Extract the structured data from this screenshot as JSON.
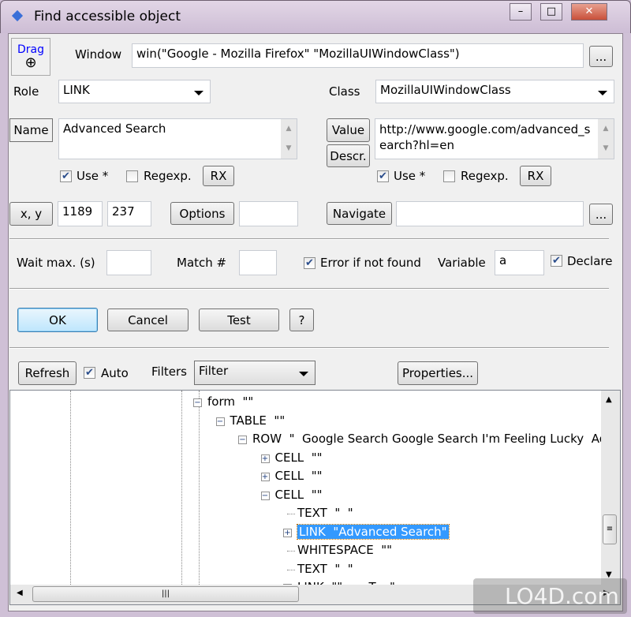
{
  "window": {
    "title": "Find accessible object",
    "minimize": "–",
    "maximize": "□",
    "close": "✕"
  },
  "top": {
    "drag_label": "Drag",
    "window_label": "Window",
    "window_value": "win(\"Google - Mozilla Firefox\" \"MozillaUIWindowClass\")",
    "browse": "...",
    "role_label": "Role",
    "role_value": "LINK",
    "class_label": "Class",
    "class_value": "MozillaUIWindowClass",
    "name_btn": "Name",
    "name_value": "Advanced Search",
    "value_btn": "Value",
    "descr_btn": "Descr.",
    "value_value": "http://www.google.com/advanced_search?hl=en",
    "use_label": "Use *",
    "regexp_label": "Regexp.",
    "rx": "RX",
    "use_left_checked": true,
    "regexp_left_checked": false,
    "use_right_checked": true,
    "regexp_right_checked": false,
    "xy_btn": "x, y",
    "x_value": "1189",
    "y_value": "237",
    "options_btn": "Options",
    "options_value": "",
    "navigate_btn": "Navigate",
    "navigate_value": ""
  },
  "wait": {
    "wait_label": "Wait max. (s)",
    "wait_value": "",
    "match_label": "Match #",
    "match_value": "",
    "error_label": "Error if not found",
    "error_checked": true,
    "variable_label": "Variable",
    "variable_value": "a",
    "declare_label": "Declare",
    "declare_checked": true
  },
  "actions": {
    "ok": "OK",
    "cancel": "Cancel",
    "test": "Test",
    "help": "?"
  },
  "filters": {
    "refresh": "Refresh",
    "auto_label": "Auto",
    "auto_checked": true,
    "filters_label": "Filters",
    "filter_value": "Filter",
    "properties": "Properties..."
  },
  "tree": [
    {
      "text": "form  \"\"",
      "level": 0,
      "expander": "minus"
    },
    {
      "text": "TABLE  \"\"",
      "level": 1,
      "expander": "minus"
    },
    {
      "text": "ROW  \"  Google Search Google Search I'm Feeling Lucky  Ad",
      "level": 2,
      "expander": "minus"
    },
    {
      "text": "CELL  \"\"",
      "level": 3,
      "expander": "plus"
    },
    {
      "text": "CELL  \"\"",
      "level": 3,
      "expander": "plus"
    },
    {
      "text": "CELL  \"\"",
      "level": 3,
      "expander": "minus"
    },
    {
      "text": "TEXT  \"  \"",
      "level": 4,
      "expander": "none"
    },
    {
      "text": "LINK  \"Advanced Search\"",
      "level": 4,
      "expander": "plus",
      "selected": true
    },
    {
      "text": "WHITESPACE  \"\"",
      "level": 4,
      "expander": "none"
    },
    {
      "text": "TEXT  \"  \"",
      "level": 4,
      "expander": "none"
    },
    {
      "text": "LINK  \"\"  ...  T... \"",
      "level": 4,
      "expander": "minus"
    }
  ],
  "watermark": "LO4D.com"
}
